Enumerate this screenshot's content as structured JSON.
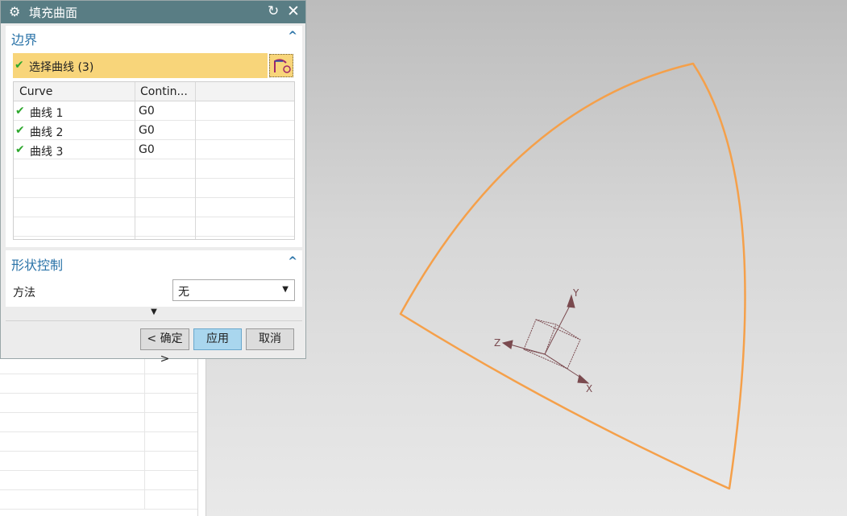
{
  "dialog": {
    "title": "填充曲面",
    "title_icon": "gear-icon",
    "reset_icon": "reset-icon",
    "close_icon": "close-icon"
  },
  "boundary": {
    "title": "边界",
    "select_label": "选择曲线 (3)",
    "columns": [
      "Curve",
      "Contin..."
    ],
    "rows": [
      {
        "name": "曲线 1",
        "continuity": "G0"
      },
      {
        "name": "曲线 2",
        "continuity": "G0"
      },
      {
        "name": "曲线 3",
        "continuity": "G0"
      }
    ]
  },
  "shape_control": {
    "title": "形状控制",
    "method_label": "方法",
    "method_value": "无"
  },
  "buttons": {
    "ok": "< 确定 >",
    "apply": "应用",
    "cancel": "取消"
  },
  "axes": {
    "x": "X",
    "y": "Y",
    "z": "Z"
  },
  "colors": {
    "titlebar": "#597d84",
    "accent_blue": "#2a73a8",
    "selection": "#f8d57a",
    "curve": "#f5a04a",
    "triad": "#7a4a4f"
  }
}
